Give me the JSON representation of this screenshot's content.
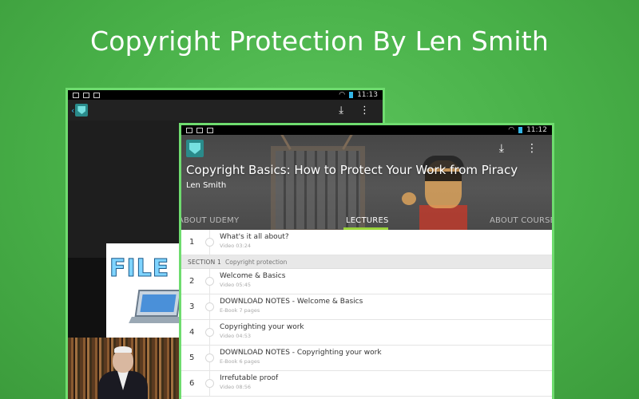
{
  "headline": "Copyright Protection By Len Smith",
  "back_screen": {
    "status_time": "11:13",
    "image_word": "FILE"
  },
  "front_screen": {
    "status_time": "11:12",
    "course_title": "Copyright Basics: How to Protect Your Work from Piracy",
    "course_author": "Len Smith",
    "tabs": [
      "ABOUT UDEMY",
      "LECTURES",
      "ABOUT COURSE"
    ],
    "active_tab": "LECTURES",
    "items": [
      {
        "kind": "lecture",
        "num": "1",
        "title": "What's it all about?",
        "meta": "Video 03:24"
      },
      {
        "kind": "section",
        "num": "SECTION 1",
        "title": "Copyright protection"
      },
      {
        "kind": "lecture",
        "num": "2",
        "title": "Welcome & Basics",
        "meta": "Video 05:45"
      },
      {
        "kind": "lecture",
        "num": "3",
        "title": "DOWNLOAD NOTES - Welcome & Basics",
        "meta": "E-Book 7 pages"
      },
      {
        "kind": "lecture",
        "num": "4",
        "title": "Copyrighting your work",
        "meta": "Video 04:53"
      },
      {
        "kind": "lecture",
        "num": "5",
        "title": "DOWNLOAD NOTES - Copyrighting your work",
        "meta": "E-Book 6 pages"
      },
      {
        "kind": "lecture",
        "num": "6",
        "title": "Irrefutable proof",
        "meta": "Video 08:56"
      }
    ]
  },
  "icons": {
    "download": "download-icon",
    "overflow": "overflow-menu-icon",
    "back": "back-chevron-icon",
    "app": "app-logo-icon"
  },
  "colors": {
    "background": "#48b048",
    "frame": "#6fdc6f",
    "tab_indicator": "#9ad33a"
  }
}
